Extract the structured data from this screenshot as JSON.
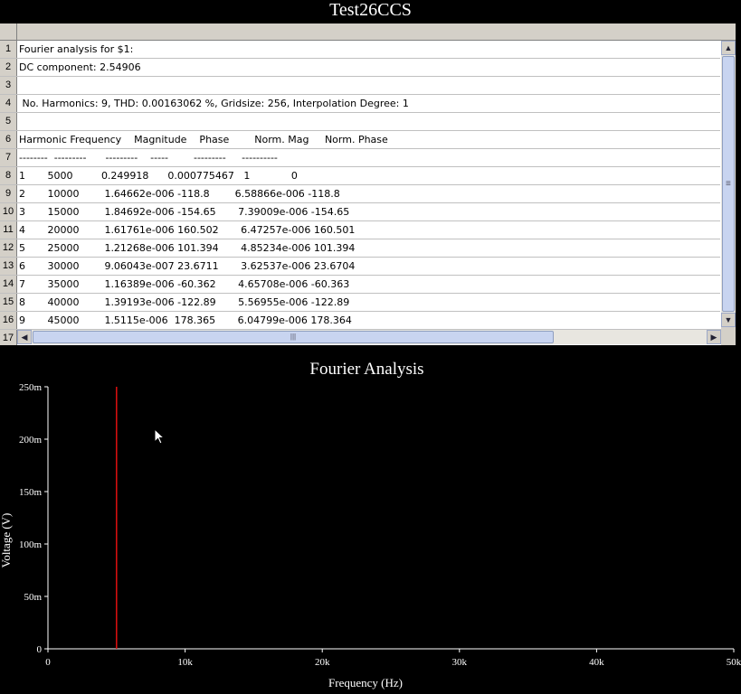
{
  "window": {
    "title": "Test26CCS"
  },
  "grid": {
    "rows": [
      {
        "num": "1",
        "text": "Fourier analysis for $1:"
      },
      {
        "num": "2",
        "text": "DC component: 2.54906"
      },
      {
        "num": "3",
        "text": ""
      },
      {
        "num": "4",
        "text": " No. Harmonics: 9, THD: 0.00163062 %, Gridsize: 256, Interpolation Degree: 1"
      },
      {
        "num": "5",
        "text": ""
      },
      {
        "num": "6",
        "text": "Harmonic Frequency    Magnitude    Phase        Norm. Mag     Norm. Phase"
      },
      {
        "num": "7",
        "text": "--------  ---------      ---------    -----        ---------     ----------"
      },
      {
        "num": "8",
        "text": "1       5000         0.249918      0.000775467   1             0"
      },
      {
        "num": "9",
        "text": "2       10000        1.64662e-006 -118.8        6.58866e-006 -118.8"
      },
      {
        "num": "10",
        "text": "3       15000        1.84692e-006 -154.65       7.39009e-006 -154.65"
      },
      {
        "num": "11",
        "text": "4       20000        1.61761e-006 160.502       6.47257e-006 160.501"
      },
      {
        "num": "12",
        "text": "5       25000        1.21268e-006 101.394       4.85234e-006 101.394"
      },
      {
        "num": "13",
        "text": "6       30000        9.06043e-007 23.6711       3.62537e-006 23.6704"
      },
      {
        "num": "14",
        "text": "7       35000        1.16389e-006 -60.362       4.65708e-006 -60.363"
      },
      {
        "num": "15",
        "text": "8       40000        1.39193e-006 -122.89       5.56955e-006 -122.89"
      },
      {
        "num": "16",
        "text": "9       45000        1.5115e-006  178.365       6.04799e-006 178.364"
      },
      {
        "num": "17",
        "text": ""
      }
    ],
    "icons": {
      "scroll_up": "▲",
      "scroll_down": "▼",
      "scroll_left": "◀",
      "scroll_right": "▶",
      "thumb_grip_v": "≡",
      "thumb_grip_h": "|||"
    }
  },
  "chart_data": {
    "type": "bar",
    "title": "Fourier Analysis",
    "xlabel": "Frequency (Hz)",
    "ylabel": "Voltage (V)",
    "x": [
      5000
    ],
    "values": [
      0.25
    ],
    "xlim": [
      0,
      50000
    ],
    "ylim": [
      0,
      0.25
    ],
    "xticks": [
      0,
      10000,
      20000,
      30000,
      40000,
      50000
    ],
    "xtick_labels": [
      "0",
      "10k",
      "20k",
      "30k",
      "40k",
      "50k"
    ],
    "yticks": [
      0,
      0.05,
      0.1,
      0.15,
      0.2,
      0.25
    ],
    "ytick_labels": [
      "0",
      "50m",
      "100m",
      "150m",
      "200m",
      "250m"
    ],
    "grid": false,
    "line_color": "#e01010",
    "axis_color": "#ffffff",
    "background": "#000000"
  }
}
